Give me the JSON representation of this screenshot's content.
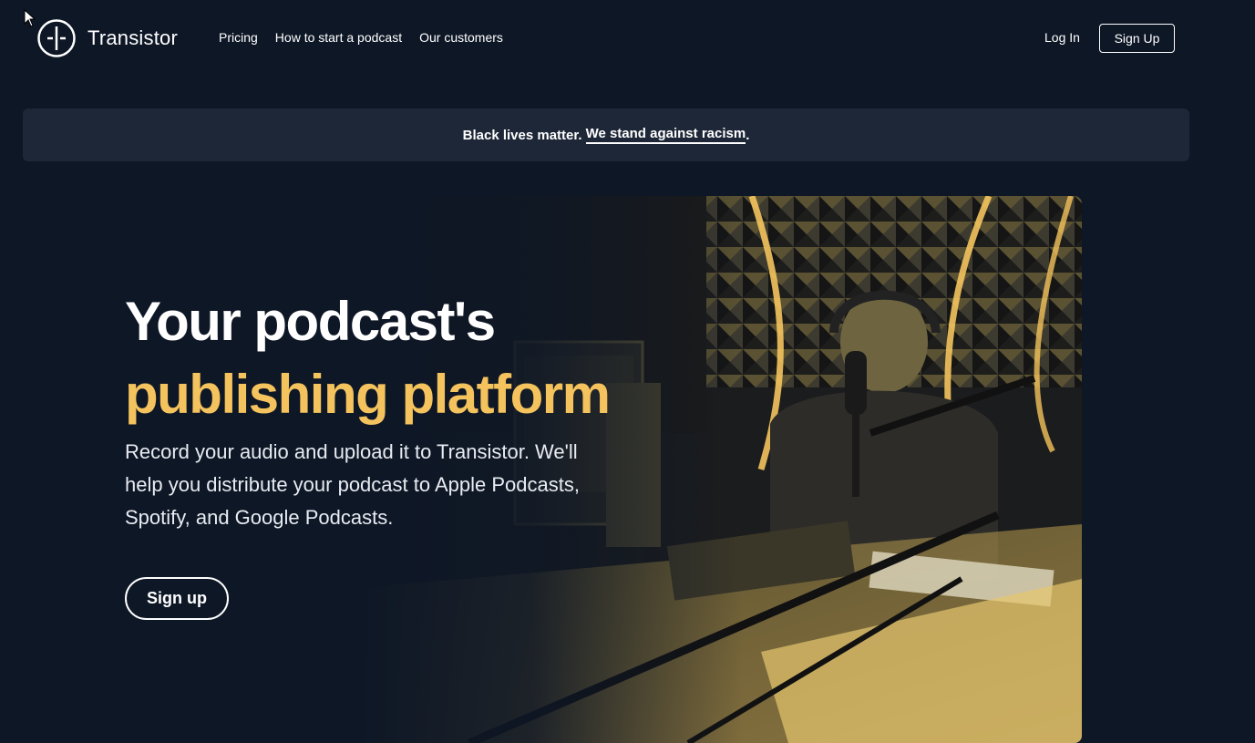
{
  "brand": {
    "name": "Transistor",
    "logo_icon": "transistor-logo-icon"
  },
  "nav": {
    "links": [
      "Pricing",
      "How to start a podcast",
      "Our customers"
    ],
    "login": "Log In",
    "signup": "Sign Up"
  },
  "banner": {
    "text": "Black lives matter.",
    "link": "We stand against racism",
    "suffix": "."
  },
  "hero": {
    "title_line1": "Your podcast's",
    "title_line2": "publishing platform",
    "description": "Record your audio and upload it to Transistor. We'll help you distribute your podcast to Apple Podcasts, Spotify, and Google Podcasts.",
    "cta": "Sign up",
    "image_subject": "podcaster-in-studio-photo"
  },
  "colors": {
    "background": "#0e1726",
    "banner": "#1e2738",
    "accent": "#f4c35d"
  }
}
